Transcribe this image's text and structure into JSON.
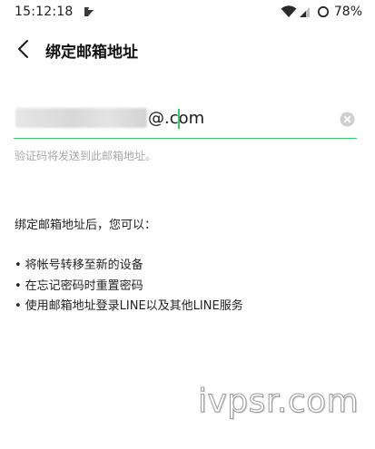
{
  "status_bar": {
    "time": "15:12:18",
    "app_icon": "notification-app-icon",
    "wifi_icon": "wifi-icon",
    "signal_icon": "cell-signal-icon",
    "battery_icon": "battery-icon",
    "battery_text": "78%"
  },
  "header": {
    "back_icon": "back-chevron-icon",
    "title": "绑定邮箱地址"
  },
  "email_field": {
    "value_suffix": "@.com",
    "clear_icon": "clear-icon",
    "accent_color": "#3dc46a"
  },
  "helper_text": "验证码将发送到此邮箱地址。",
  "benefits": {
    "heading": "绑定邮箱地址后，您可以：",
    "items": [
      "将帐号转移至新的设备",
      "在忘记密码时重置密码",
      "使用邮箱地址登录LINE以及其他LINE服务"
    ]
  },
  "watermark": "ivpsr.com"
}
